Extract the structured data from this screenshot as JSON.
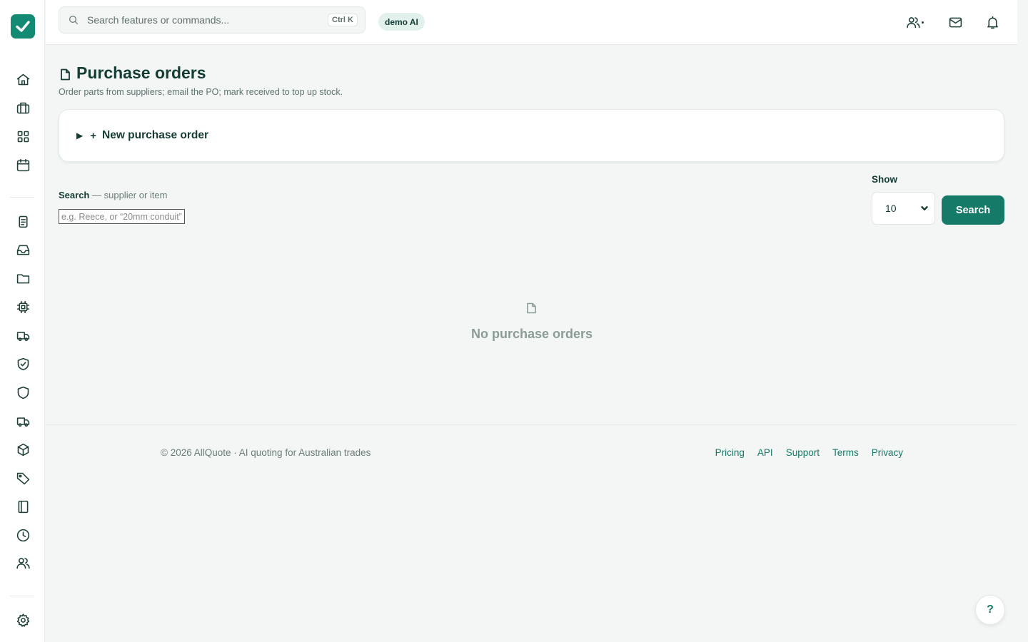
{
  "header": {
    "search_placeholder": "Search features or commands...",
    "shortcut": "Ctrl K",
    "badge": "demo AI"
  },
  "sidebar": {
    "icons": [
      "home-icon",
      "briefcase-icon",
      "grid-icon",
      "calendar-icon",
      "clipboard-icon",
      "inbox-icon",
      "folder-icon",
      "chip-icon",
      "truck-icon",
      "shield-check-icon",
      "shield-icon",
      "truck-icon",
      "box-icon",
      "tag-icon",
      "book-icon",
      "clock-icon",
      "users-icon",
      "gear-icon"
    ]
  },
  "page": {
    "title": "Purchase orders",
    "subtitle": "Order parts from suppliers; email the PO; mark received to top up stock."
  },
  "new_order": {
    "toggle": "▶",
    "plus": "+",
    "label": "New purchase order"
  },
  "filters": {
    "search_label": "Search",
    "search_hint": "— supplier or item",
    "search_placeholder": "e.g. Reece, or “20mm conduit”",
    "show_label": "Show",
    "show_value": "10",
    "search_button": "Search"
  },
  "empty_state": {
    "text": "No purchase orders"
  },
  "footer": {
    "copyright": "© 2026 AllQuote · AI quoting for Australian trades",
    "links": [
      "Pricing",
      "API",
      "Support",
      "Terms",
      "Privacy"
    ]
  },
  "help_label": "?",
  "colors": {
    "brand": "#138a74",
    "primary_button": "#157a68",
    "text_dark": "#143c35",
    "background": "#f3f6f5"
  }
}
